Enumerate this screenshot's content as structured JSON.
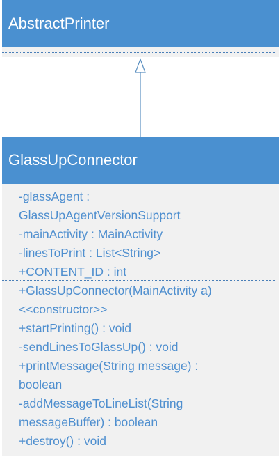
{
  "superclass": {
    "name": "AbstractPrinter"
  },
  "subclass": {
    "name": "GlassUpConnector",
    "attributes": [
      "-glassAgent :",
      "GlassUpAgentVersionSupport",
      "-mainActivity : MainActivity",
      "-linesToPrint : List<String>",
      "+CONTENT_ID : int"
    ],
    "operations": [
      "+GlassUpConnector(MainActivity a)",
      "<<constructor>>",
      "+startPrinting() : void",
      "-sendLinesToGlassUp() : void",
      "+printMessage(String message) :",
      "boolean",
      "-addMessageToLineList(String",
      "messageBuffer) : boolean",
      "+destroy() : void"
    ]
  },
  "colors": {
    "header": "#4a90d0",
    "body": "#f1f1f1",
    "text": "#4f8fcf",
    "arrow": "#5a8fc0"
  }
}
